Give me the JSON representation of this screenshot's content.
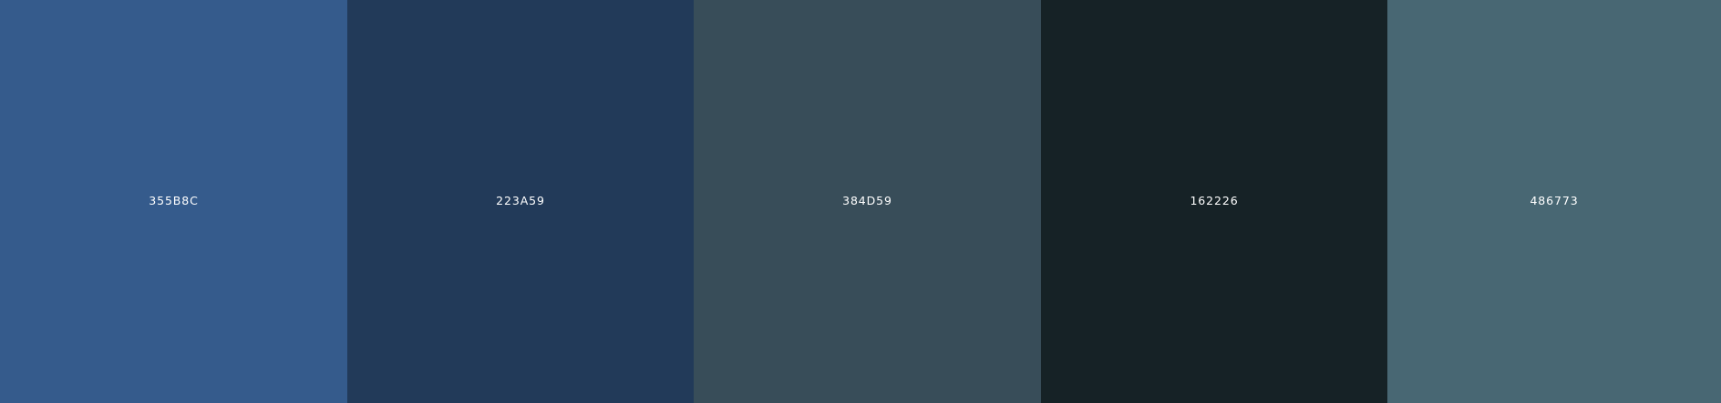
{
  "palette": {
    "colors": [
      {
        "hex": "#355B8C",
        "label": "355B8C"
      },
      {
        "hex": "#223A59",
        "label": "223A59"
      },
      {
        "hex": "#384D59",
        "label": "384D59"
      },
      {
        "hex": "#162226",
        "label": "162226"
      },
      {
        "hex": "#486773",
        "label": "486773"
      }
    ]
  }
}
